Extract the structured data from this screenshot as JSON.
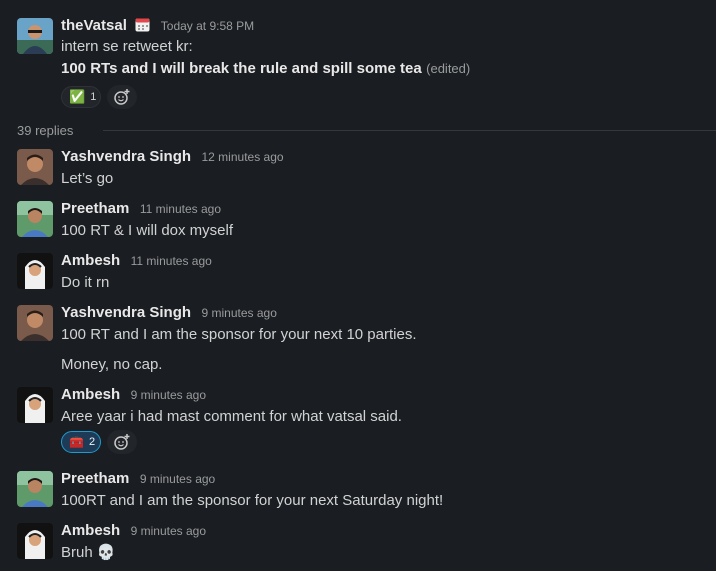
{
  "parent": {
    "author": "theVatsal",
    "status_emoji": "calendar-icon",
    "time": "Today at 9:58 PM",
    "line1": "intern se retweet kr:",
    "line2": "100 RTs and I will break the rule and spill some tea",
    "edited": "(edited)",
    "reaction": {
      "emoji": "✅",
      "count": "1"
    }
  },
  "thread": {
    "replies_label": "39 replies"
  },
  "messages": [
    {
      "author": "Yashvendra Singh",
      "time": "12 minutes ago",
      "lines": [
        "Let’s go"
      ]
    },
    {
      "author": "Preetham",
      "time": "11 minutes ago",
      "lines": [
        "100 RT & I will dox myself"
      ]
    },
    {
      "author": "Ambesh",
      "time": "11 minutes ago",
      "lines": [
        "Do it rn"
      ]
    },
    {
      "author": "Yashvendra Singh",
      "time": "9 minutes ago",
      "lines": [
        "100 RT and I am the sponsor for your next 10 parties.",
        "Money, no cap."
      ]
    },
    {
      "author": "Ambesh",
      "time": "9 minutes ago",
      "lines": [
        "Aree yaar i had mast comment for what vatsal said."
      ],
      "reaction": {
        "emoji": "🧰",
        "count": "2"
      }
    },
    {
      "author": "Preetham",
      "time": "9 minutes ago",
      "lines": [
        "100RT and I am the sponsor for your next Saturday night!"
      ]
    },
    {
      "author": "Ambesh",
      "time": "9 minutes ago",
      "lines": [
        "Bruh 💀"
      ]
    }
  ],
  "colors": {
    "background": "#1a1d21",
    "active_reaction": "#1d3a57",
    "active_border": "#1d9bd1"
  }
}
